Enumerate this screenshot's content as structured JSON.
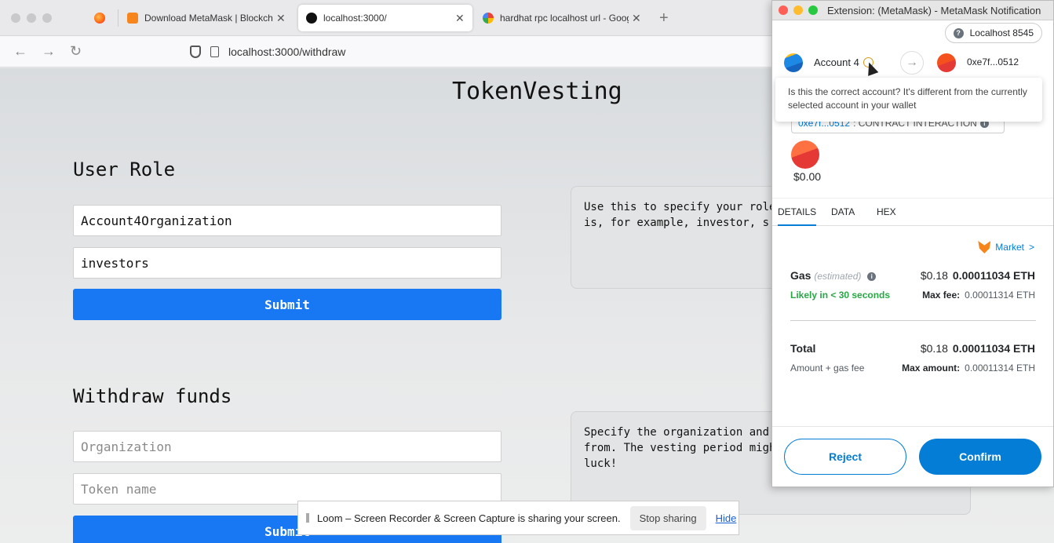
{
  "browser": {
    "tabs": [
      {
        "label": "",
        "icon": "firefox-icon"
      },
      {
        "label": "Download MetaMask | Blockcha",
        "icon": "metamask-fox-icon"
      },
      {
        "label": "localhost:3000/",
        "icon": "vercel-triangle-icon"
      },
      {
        "label": "hardhat rpc localhost url - Goog",
        "icon": "google-icon"
      }
    ],
    "close_glyph": "✕",
    "new_tab_glyph": "+",
    "back_glyph": "←",
    "forward_glyph": "→",
    "reload_glyph": "↻",
    "url": "localhost:3000/withdraw"
  },
  "page": {
    "title": "TokenVesting",
    "user_role": {
      "heading": "User Role",
      "organization_value": "Account4Organization",
      "role_value": "investors",
      "submit_label": "Submit",
      "info_text": "Use this to specify your role in the organization. Role\nis, for example, investor, s"
    },
    "withdraw": {
      "heading": "Withdraw funds",
      "organization_placeholder": "Organization",
      "token_placeholder": "Token name",
      "submit_label": "Submit",
      "info_text": "Specify the organization and token you want to withdraw\nfrom. The vesting period migh\nluck!"
    }
  },
  "loom": {
    "message": "Loom – Screen Recorder & Screen Capture is sharing your screen.",
    "stop_label": "Stop sharing",
    "hide_label": "Hide"
  },
  "metamask": {
    "window_title": "Extension: (MetaMask) - MetaMask Notification",
    "network": "Localhost 8545",
    "network_icon_glyph": "?",
    "from_account": "Account 4",
    "to_address": "0xe7f...0512",
    "arrow_glyph": "→",
    "tooltip": "Is this the correct account? It's different from the currently selected account in your wallet",
    "contract_address": "0xe7f...0512",
    "contract_label": ": CONTRACT INTERACTION",
    "info_glyph": "i",
    "amount": "$0.00",
    "tabs": [
      "DETAILS",
      "DATA",
      "HEX"
    ],
    "market_label": "Market",
    "market_chevron": ">",
    "gas": {
      "label": "Gas",
      "estimated": "(estimated)",
      "fiat": "$0.18",
      "eth": "0.00011034 ETH",
      "likely": "Likely in < 30 seconds",
      "max_fee_label": "Max fee:",
      "max_fee_value": "0.00011314 ETH"
    },
    "total": {
      "label": "Total",
      "fiat": "$0.18",
      "eth": "0.00011034 ETH",
      "sub_label": "Amount + gas fee",
      "max_amount_label": "Max amount:",
      "max_amount_value": "0.00011314 ETH"
    },
    "reject_label": "Reject",
    "confirm_label": "Confirm",
    "colors": {
      "accent": "#037dd6",
      "success": "#28a745",
      "warning": "#d89a1f"
    }
  }
}
